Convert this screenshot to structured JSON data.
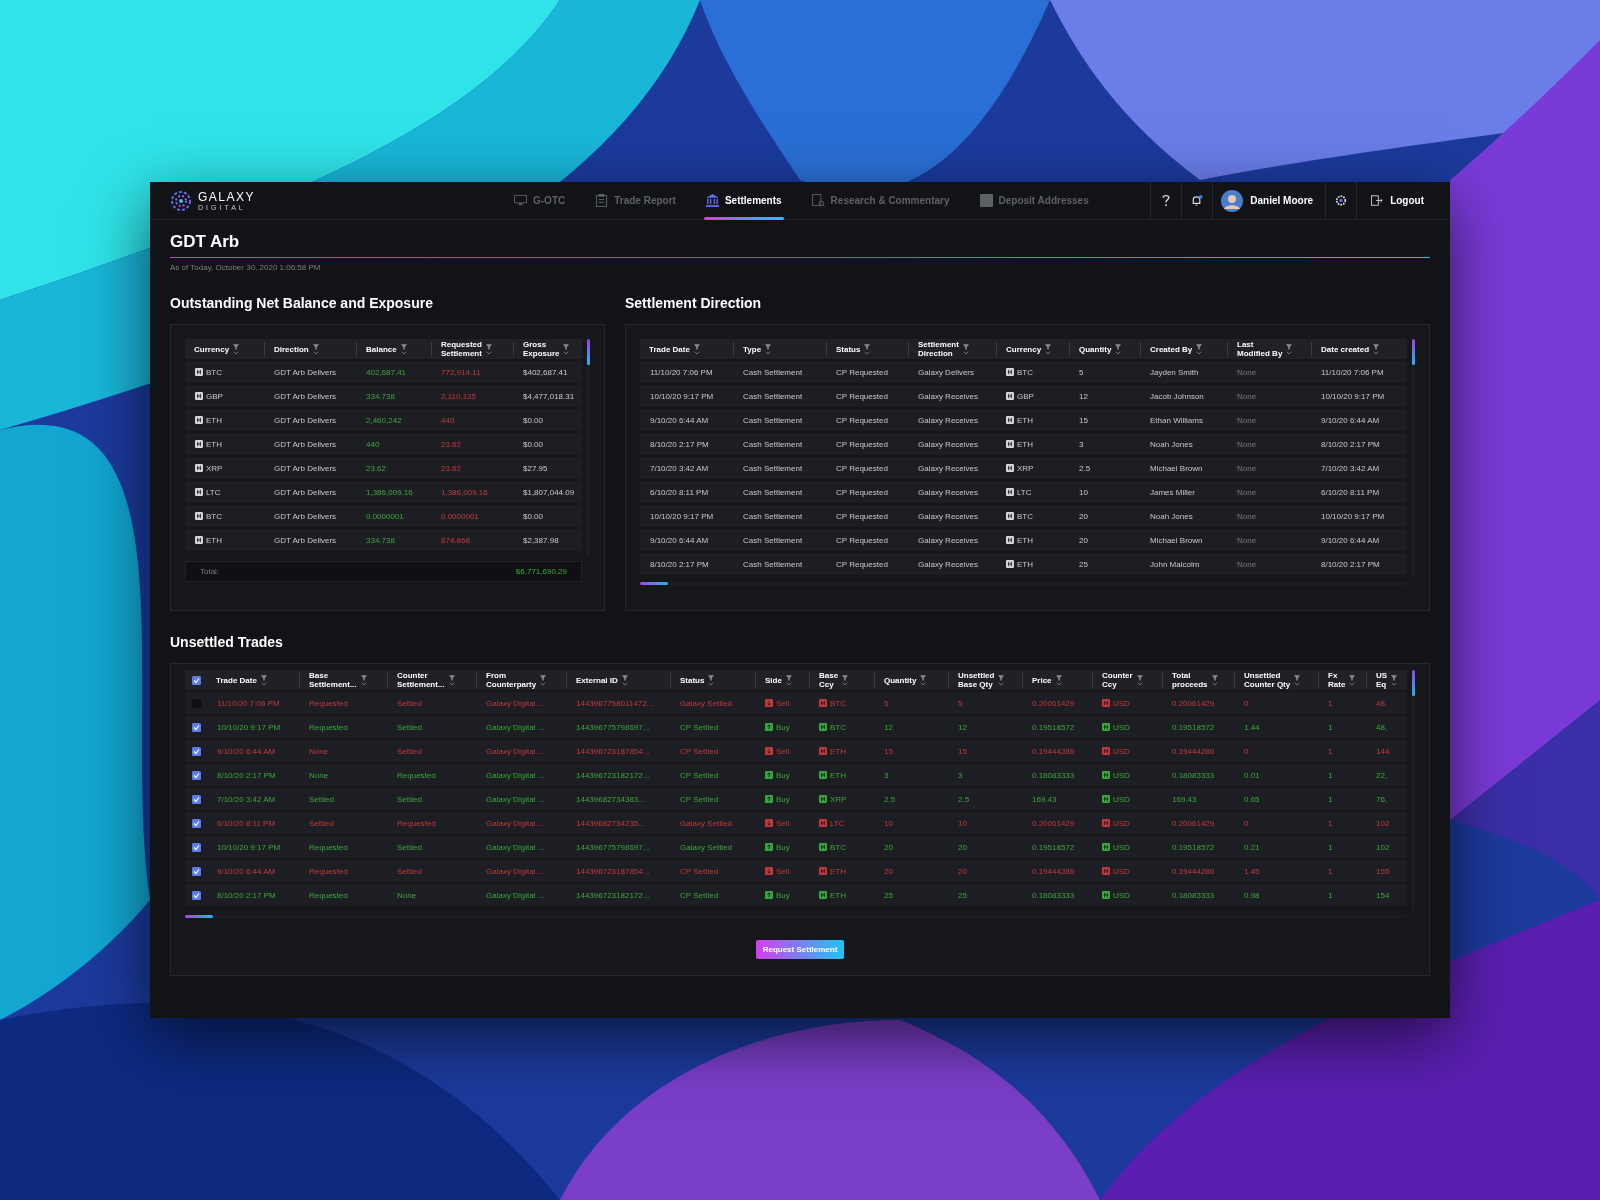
{
  "brand": {
    "name": "GALAXY",
    "sub": "DIGITAL"
  },
  "nav": [
    {
      "label": "G-OTC",
      "selected": false
    },
    {
      "label": "Trade Report",
      "selected": false
    },
    {
      "label": "Settlements",
      "selected": true
    },
    {
      "label": "Research & Commentary",
      "selected": false
    },
    {
      "label": "Deposit Addresses",
      "selected": false
    }
  ],
  "user": {
    "name": "Daniel Moore"
  },
  "logout": "Logout",
  "page": {
    "title": "GDT Arb",
    "as_of": "As of Today, October 30, 2020 1:06:58 PM"
  },
  "balance": {
    "title": "Outstanding Net Balance and Exposure",
    "columns": [
      {
        "label": "Currency",
        "kind": "ccy"
      },
      {
        "label": "Direction",
        "kind": "text"
      },
      {
        "label": "Balance",
        "kind": "positive"
      },
      {
        "label": "Requested\nSettlement",
        "kind": "negative"
      },
      {
        "label": "Gross\nExposure",
        "kind": "text"
      }
    ],
    "rows": [
      [
        "BTC",
        "GDT Arb Delivers",
        "402,687.41",
        "772,914.11",
        "$402,687.41"
      ],
      [
        "GBP",
        "GDT Arb Delivers",
        "334.738",
        "2,110,135",
        "$4,477,018.31"
      ],
      [
        "ETH",
        "GDT Arb Delivers",
        "2,460,242",
        "440",
        "$0.00"
      ],
      [
        "ETH",
        "GDT Arb Delivers",
        "440",
        "23.62",
        "$0.00"
      ],
      [
        "XRP",
        "GDT Arb Delivers",
        "23.62",
        "23.62",
        "$27.95"
      ],
      [
        "LTC",
        "GDT Arb Delivers",
        "1,386,009.16",
        "1,386,009.16",
        "$1,807,044.09"
      ],
      [
        "BTC",
        "GDT Arb Delivers",
        "0.0000001",
        "0.0000001",
        "$0.00"
      ],
      [
        "ETH",
        "GDT Arb Delivers",
        "334.738",
        "874.868",
        "$2,387.98"
      ]
    ],
    "total_label": "Total:",
    "total": "$6,771,690.29"
  },
  "settlement_direction": {
    "title": "Settlement Direction",
    "columns": [
      {
        "label": "Trade Date",
        "kind": "text"
      },
      {
        "label": "Type",
        "kind": "text"
      },
      {
        "label": "Status",
        "kind": "text"
      },
      {
        "label": "Settlement\nDirection",
        "kind": "text"
      },
      {
        "label": "Currency",
        "kind": "ccy"
      },
      {
        "label": "Quantity",
        "kind": "text"
      },
      {
        "label": "Created By",
        "kind": "text"
      },
      {
        "label": "Last\nModified By",
        "kind": "muted"
      },
      {
        "label": "Date created",
        "kind": "text"
      }
    ],
    "rows": [
      [
        "11/10/20 7:06 PM",
        "Cash Settlement",
        "CP Requested",
        "Galaxy Delivers",
        "BTC",
        "5",
        "Jayden Smith",
        "None",
        "11/10/20 7:06 PM"
      ],
      [
        "10/10/20 9:17 PM",
        "Cash Settlement",
        "CP Requested",
        "Galaxy Receives",
        "GBP",
        "12",
        "Jacob Johnson",
        "None",
        "10/10/20 9:17 PM"
      ],
      [
        "9/10/20 6:44 AM",
        "Cash Settlement",
        "CP Requested",
        "Galaxy Receives",
        "ETH",
        "15",
        "Ethan Williams",
        "None",
        "9/10/20 6:44 AM"
      ],
      [
        "8/10/20 2:17 PM",
        "Cash Settlement",
        "CP Requested",
        "Galaxy Receives",
        "ETH",
        "3",
        "Noah Jones",
        "None",
        "8/10/20 2:17 PM"
      ],
      [
        "7/10/20 3:42 AM",
        "Cash Settlement",
        "CP Requested",
        "Galaxy Receives",
        "XRP",
        "2.5",
        "Michael Brown",
        "None",
        "7/10/20 3:42 AM"
      ],
      [
        "6/10/20 8:11 PM",
        "Cash Settlement",
        "CP Requested",
        "Galaxy Receives",
        "LTC",
        "10",
        "James Miller",
        "None",
        "6/10/20 8:11 PM"
      ],
      [
        "10/10/20 9:17 PM",
        "Cash Settlement",
        "CP Requested",
        "Galaxy Receives",
        "BTC",
        "20",
        "Noah Jones",
        "None",
        "10/10/20 9:17 PM"
      ],
      [
        "9/10/20 6:44 AM",
        "Cash Settlement",
        "CP Requested",
        "Galaxy Receives",
        "ETH",
        "20",
        "Michael Brown",
        "None",
        "9/10/20 6:44 AM"
      ],
      [
        "8/10/20 2:17 PM",
        "Cash Settlement",
        "CP Requested",
        "Galaxy Receives",
        "ETH",
        "25",
        "John Malcolm",
        "None",
        "8/10/20 2:17 PM"
      ]
    ]
  },
  "unsettled": {
    "title": "Unsettled Trades",
    "all_checked": true,
    "columns": [
      {
        "label": "Trade Date",
        "kind": "text"
      },
      {
        "label": "Base\nSettlement...",
        "kind": "text"
      },
      {
        "label": "Counter\nSettlement...",
        "kind": "text"
      },
      {
        "label": "From\nCounterparty",
        "kind": "text"
      },
      {
        "label": "External ID",
        "kind": "text"
      },
      {
        "label": "Status",
        "kind": "text"
      },
      {
        "label": "Side",
        "kind": "side"
      },
      {
        "label": "Base\nCcy",
        "kind": "ccy"
      },
      {
        "label": "Quantity",
        "kind": "text"
      },
      {
        "label": "Unsettled\nBase Qty",
        "kind": "text"
      },
      {
        "label": "Price",
        "kind": "text"
      },
      {
        "label": "Counter\nCcy",
        "kind": "ccy"
      },
      {
        "label": "Total\nproceeds",
        "kind": "text"
      },
      {
        "label": "Unsettled\nCounter Qty",
        "kind": "text"
      },
      {
        "label": "Fx\nRate",
        "kind": "text"
      },
      {
        "label": "US\nEq",
        "kind": "text"
      }
    ],
    "rows": [
      {
        "checked": false,
        "kind": "sell",
        "cells": [
          "11/10/20 7:06 PM",
          "Requested",
          "Settled",
          "Galaxy Digital ...",
          "1443967758011472...",
          "Galaxy Settled",
          "Sell",
          "BTC",
          "5",
          "5",
          "0.20061429",
          "USD",
          "0.20061429",
          "0",
          "1",
          "48,"
        ]
      },
      {
        "checked": true,
        "kind": "buy",
        "cells": [
          "10/10/20 9:17 PM",
          "Requested",
          "Settled",
          "Galaxy Digital ...",
          "144396775798697...",
          "CP Settled",
          "Buy",
          "BTC",
          "12",
          "12",
          "0.19518572",
          "USD",
          "0.19518572",
          "1.44",
          "1",
          "48,"
        ]
      },
      {
        "checked": true,
        "kind": "sell",
        "cells": [
          "9/10/20 6:44 AM",
          "None",
          "Settled",
          "Galaxy Digital ...",
          "144396723187854...",
          "CP Settled",
          "Sell",
          "ETH",
          "15",
          "15",
          "0.19444286",
          "USD",
          "0.19444286",
          "0",
          "1",
          "144"
        ]
      },
      {
        "checked": true,
        "kind": "buy",
        "cells": [
          "8/10/20 2:17 PM",
          "None",
          "Requested",
          "Galaxy Digital ...",
          "144396723182172...",
          "CP Settled",
          "Buy",
          "ETH",
          "3",
          "3",
          "0.18083333",
          "USD",
          "0.18083333",
          "0.01",
          "1",
          "22,"
        ]
      },
      {
        "checked": true,
        "kind": "buy",
        "cells": [
          "7/10/20 3:42 AM",
          "Settled",
          "Settled",
          "Galaxy Digital ...",
          "14439682734383...",
          "CP Settled",
          "Buy",
          "XRP",
          "2.5",
          "2.5",
          "169.43",
          "USD",
          "169.43",
          "0.65",
          "1",
          "76,"
        ]
      },
      {
        "checked": true,
        "kind": "sell",
        "cells": [
          "6/10/20 8:11 PM",
          "Settled",
          "Requested",
          "Galaxy Digital ...",
          "14439682734235...",
          "Galaxy Settled",
          "Sell",
          "LTC",
          "10",
          "10",
          "0.20061429",
          "USD",
          "0.20061429",
          "0",
          "1",
          "102"
        ]
      },
      {
        "checked": true,
        "kind": "buy",
        "cells": [
          "10/10/20 9:17 PM",
          "Requested",
          "Settled",
          "Galaxy Digital ...",
          "144396775798697...",
          "Galaxy Settled",
          "Buy",
          "BTC",
          "20",
          "20",
          "0.19518572",
          "USD",
          "0.19518572",
          "0.21",
          "1",
          "102"
        ]
      },
      {
        "checked": true,
        "kind": "sell",
        "cells": [
          "9/10/20 6:44 AM",
          "Requested",
          "Settled",
          "Galaxy Digital ...",
          "144396723187854...",
          "CP Settled",
          "Sell",
          "ETH",
          "20",
          "20",
          "0.19444286",
          "USD",
          "0.19444286",
          "1.45",
          "1",
          "155"
        ]
      },
      {
        "checked": true,
        "kind": "buy",
        "cells": [
          "8/10/20 2:17 PM",
          "Requested",
          "None",
          "Galaxy Digital ...",
          "144396723182172...",
          "CP Settled",
          "Buy",
          "ETH",
          "25",
          "25",
          "0.18083333",
          "USD",
          "0.18083333",
          "0.98",
          "1",
          "154"
        ]
      }
    ],
    "button": "Request Settlement"
  }
}
